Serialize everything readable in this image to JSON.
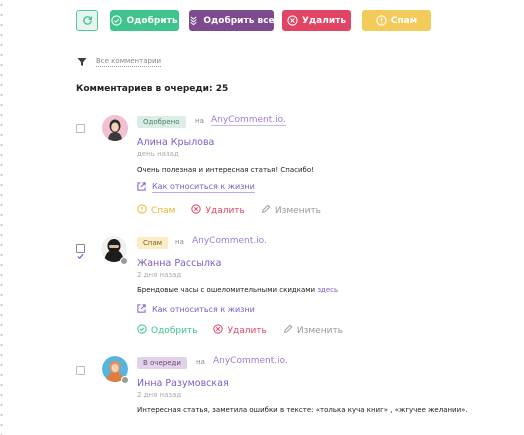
{
  "toolbar": {
    "approve_label": "Одобрить",
    "approve_all_label": "Одобрить все",
    "delete_label": "Удалить",
    "spam_label": "Спам"
  },
  "filter": {
    "label": "Все комментарии"
  },
  "queue": {
    "title": "Комментариев в очереди: 25"
  },
  "comments": [
    {
      "checked": false,
      "status": "Одобрено",
      "on_label": "на",
      "site": "AnyComment.io.",
      "author": "Алина Крылова",
      "time": "день назад",
      "text": "Очень полезная и интересная статья! Спасибо!",
      "page_link": "Как относиться к жизни",
      "actions": [
        "Спам",
        "Удалить",
        "Изменить"
      ]
    },
    {
      "checked": true,
      "status": "Спам",
      "on_label": "на",
      "site": "AnyComment.io.",
      "author": "Жанна Рассылка",
      "time": "2 дня назад",
      "text": "Брендовые часы с ошеломительными скидками",
      "text_link": "здесь",
      "page_link": "Как относиться к жизни",
      "actions": [
        "Одобрить",
        "Удалить",
        "Изменить"
      ]
    },
    {
      "checked": false,
      "status": "В очереди",
      "on_label": "на",
      "site": "AnyComment.io.",
      "author": "Инна Разумовская",
      "time": "2 дня назад",
      "text": "Интересная статья, заметила ошибки в тексте: «толька куча книг» , «жгучее желании»."
    }
  ],
  "colors": {
    "approve": "#3ec48c",
    "approve_all": "#7e4a8f",
    "delete": "#e24464",
    "spam": "#f3cb5b",
    "author": "#7c5cc4"
  },
  "icons": {
    "refresh": "refresh-icon",
    "approve": "check-circle-icon",
    "approve_all": "double-chevron-icon",
    "delete": "x-circle-icon",
    "spam": "exclamation-circle-icon",
    "filter": "filter-funnel-icon",
    "link": "external-link-icon",
    "edit": "pencil-icon"
  }
}
